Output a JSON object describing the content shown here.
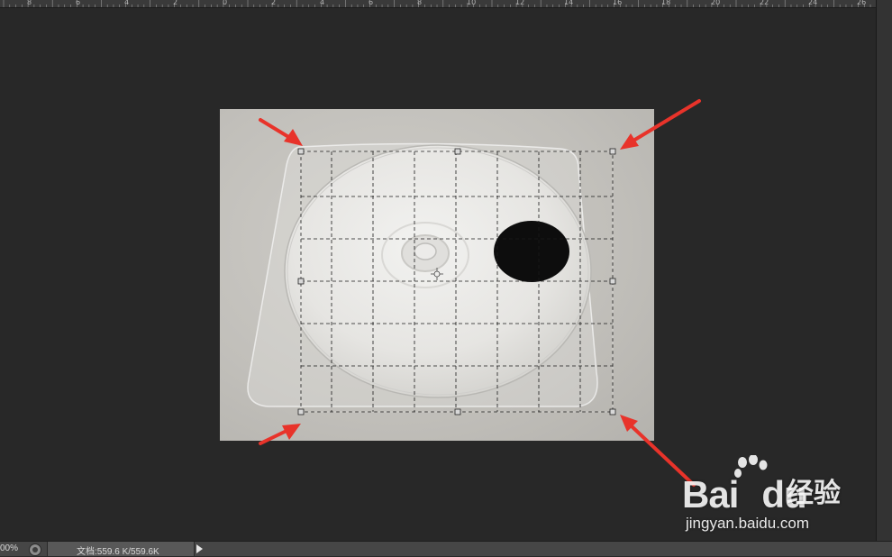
{
  "ruler": {
    "labels": [
      "8",
      "6",
      "4",
      "2",
      "0",
      "2",
      "4",
      "6",
      "8",
      "10",
      "12",
      "14",
      "16",
      "18",
      "20",
      "22",
      "24",
      "26"
    ]
  },
  "status": {
    "zoom": "00%",
    "doc_info": "文档:559.6 K/559.6K"
  },
  "watermark": {
    "brand_text": "Bai",
    "brand_text_2": "du",
    "cn_text": "经验",
    "url": "jingyan.baidu.com"
  },
  "icons": {
    "status": "status-circle-icon",
    "menu": "play-arrow-icon",
    "paw": "baidu-paw-icon"
  },
  "colors": {
    "arrow": "#e8332a",
    "canvas_bg": "#282828",
    "disc_label": "#0d0d0d"
  }
}
